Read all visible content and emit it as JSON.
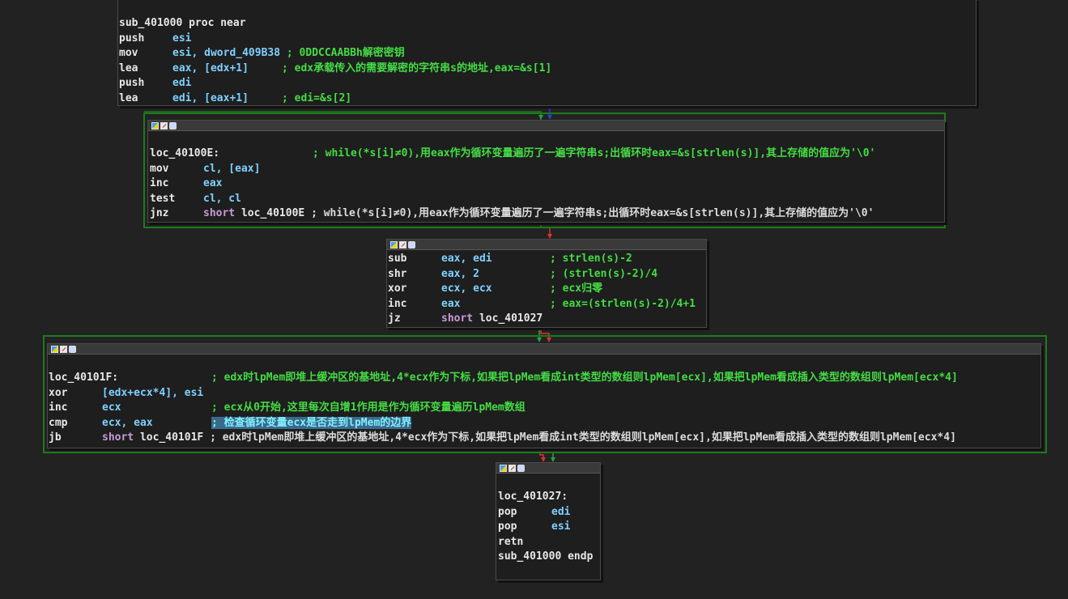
{
  "colors": {
    "background": "#222222",
    "node_bg": "#1e1e1e",
    "selected_border": "#1d7a1d",
    "comment": "#44dd44",
    "operand": "#7fd1ff",
    "keyword": "#c79bd8",
    "edge_true": "#2ea043",
    "edge_false": "#e03030",
    "edge_uncond": "#2040e0"
  },
  "block1": {
    "l0": "sub_401000 proc near",
    "l1_mn": "push",
    "l1_op": "esi",
    "l2_mn": "mov",
    "l2_op": "esi, dword_409B38",
    "l2_cm": "; 0DDCCAABBh解密密钥",
    "l3_mn": "lea",
    "l3_op": "eax, [edx+1]",
    "l3_cm": "; edx承载传入的需要解密的字符串s的地址,eax=&s[1]",
    "l4_mn": "push",
    "l4_op": "edi",
    "l5_mn": "lea",
    "l5_op": "edi, [eax+1]",
    "l5_cm": "; edi=&s[2]"
  },
  "block2": {
    "label": "loc_40100E:",
    "label_cm": "; while(*s[i]≠0),用eax作为循环变量遍历了一遍字符串s;出循环时eax=&s[strlen(s)],其上存储的值应为'\\0'",
    "l1_mn": "mov",
    "l1_op": "cl, [eax]",
    "l2_mn": "inc",
    "l2_op": "eax",
    "l3_mn": "test",
    "l3_op": "cl, cl",
    "l4_mn": "jnz",
    "l4_kw": "short",
    "l4_op": "loc_40100E",
    "l4_cm": "; while(*s[i]≠0),用eax作为循环变量遍历了一遍字符串s;出循环时eax=&s[strlen(s)],其上存储的值应为'\\0'"
  },
  "block3": {
    "l1_mn": "sub",
    "l1_op": "eax, edi",
    "l1_cm": "; strlen(s)-2",
    "l2_mn": "shr",
    "l2_op": "eax, 2",
    "l2_cm": "; (strlen(s)-2)/4",
    "l3_mn": "xor",
    "l3_op": "ecx, ecx",
    "l3_cm": "; ecx归零",
    "l4_mn": "inc",
    "l4_op": "eax",
    "l4_cm": "; eax=(strlen(s)-2)/4+1",
    "l5_mn": "jz",
    "l5_kw": "short",
    "l5_op": "loc_401027"
  },
  "block4": {
    "label": "loc_40101F:",
    "label_cm": "; edx时lpMem即堆上缓冲区的基地址,4*ecx作为下标,如果把lpMem看成int类型的数组则lpMem[ecx],如果把lpMem看成插入类型的数组则lpMem[ecx*4]",
    "l1_mn": "xor",
    "l1_op": "[edx+ecx*4], esi",
    "l2_mn": "inc",
    "l2_op": "ecx",
    "l2_cm": "; ecx从0开始,这里每次自增1作用是作为循环变量遍历lpMem数组",
    "l3_mn": "cmp",
    "l3_op": "ecx, eax",
    "l3_cm": "; 检查循环变量ecx是否走到lpMem的边界",
    "l4_mn": "jb",
    "l4_kw": "short",
    "l4_op": "loc_40101F",
    "l4_cm": "; edx时lpMem即堆上缓冲区的基地址,4*ecx作为下标,如果把lpMem看成int类型的数组则lpMem[ecx],如果把lpMem看成插入类型的数组则lpMem[ecx*4]"
  },
  "block5": {
    "label": "loc_401027:",
    "l1_mn": "pop",
    "l1_op": "edi",
    "l2_mn": "pop",
    "l2_op": "esi",
    "l3_mn": "retn",
    "l4": "sub_401000 endp"
  }
}
